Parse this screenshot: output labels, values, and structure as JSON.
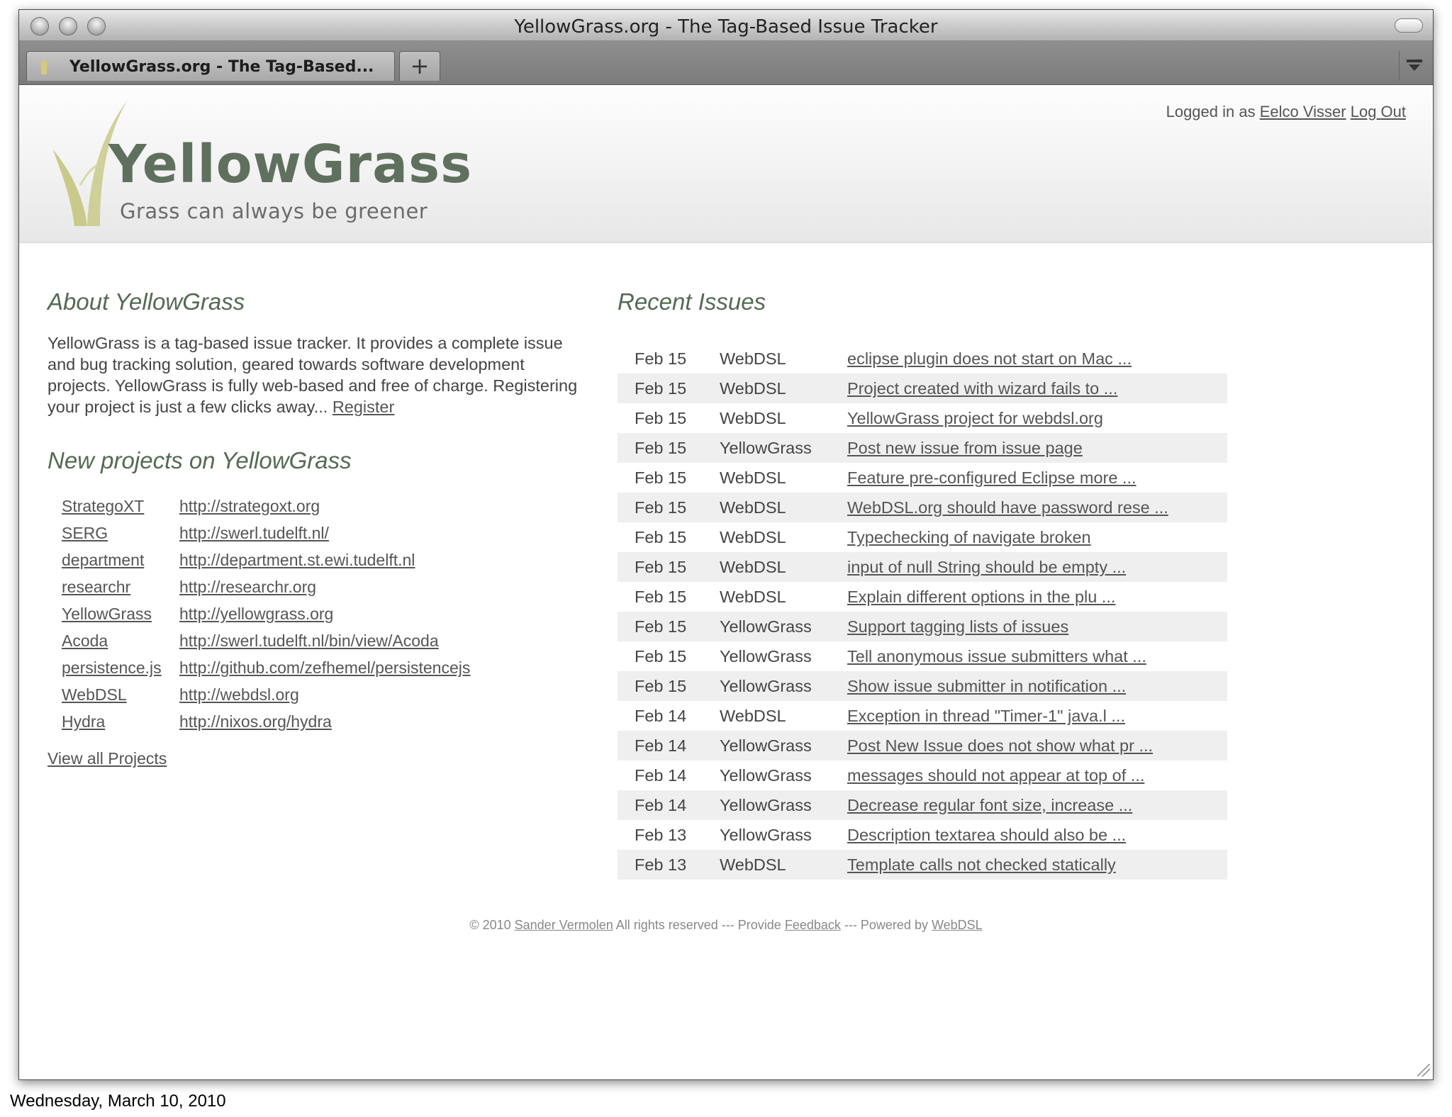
{
  "window": {
    "title": "YellowGrass.org - The Tag-Based Issue Tracker",
    "tab_label": "YellowGrass.org - The Tag-Based...",
    "new_tab_label": "+"
  },
  "header": {
    "logo_title": "YellowGrass",
    "logo_tagline": "Grass can always be greener",
    "logged_in_prefix": "Logged in as",
    "user_name": "Eelco Visser",
    "logout_label": "Log Out"
  },
  "about": {
    "heading": "About YellowGrass",
    "text": "YellowGrass is a tag-based issue tracker. It provides a complete issue and bug tracking solution, geared towards software development projects. YellowGrass is fully web-based and free of charge. Registering your project is just a few clicks away...",
    "register_label": "Register"
  },
  "new_projects": {
    "heading": "New projects on YellowGrass",
    "projects": [
      {
        "name": "StrategoXT",
        "url": "http://strategoxt.org"
      },
      {
        "name": "SERG",
        "url": "http://swerl.tudelft.nl/"
      },
      {
        "name": "department",
        "url": "http://department.st.ewi.tudelft.nl"
      },
      {
        "name": "researchr",
        "url": "http://researchr.org"
      },
      {
        "name": "YellowGrass",
        "url": "http://yellowgrass.org"
      },
      {
        "name": "Acoda",
        "url": "http://swerl.tudelft.nl/bin/view/Acoda"
      },
      {
        "name": "persistence.js",
        "url": "http://github.com/zefhemel/persistencejs"
      },
      {
        "name": "WebDSL",
        "url": "http://webdsl.org"
      },
      {
        "name": "Hydra",
        "url": "http://nixos.org/hydra"
      }
    ],
    "view_all_label": "View all Projects"
  },
  "recent_issues": {
    "heading": "Recent Issues",
    "issues": [
      {
        "date": "Feb 15",
        "project": "WebDSL",
        "title": "eclipse plugin does not start on Mac ..."
      },
      {
        "date": "Feb 15",
        "project": "WebDSL",
        "title": "Project created with wizard fails to ..."
      },
      {
        "date": "Feb 15",
        "project": "WebDSL",
        "title": "YellowGrass project for webdsl.org"
      },
      {
        "date": "Feb 15",
        "project": "YellowGrass",
        "title": "Post new issue from issue page"
      },
      {
        "date": "Feb 15",
        "project": "WebDSL",
        "title": "Feature pre-configured Eclipse more ..."
      },
      {
        "date": "Feb 15",
        "project": "WebDSL",
        "title": "WebDSL.org should have password rese ..."
      },
      {
        "date": "Feb 15",
        "project": "WebDSL",
        "title": "Typechecking of navigate broken"
      },
      {
        "date": "Feb 15",
        "project": "WebDSL",
        "title": "input of null String should be empty ..."
      },
      {
        "date": "Feb 15",
        "project": "WebDSL",
        "title": "Explain different options in the plu ..."
      },
      {
        "date": "Feb 15",
        "project": "YellowGrass",
        "title": "Support tagging lists of issues"
      },
      {
        "date": "Feb 15",
        "project": "YellowGrass",
        "title": "Tell anonymous issue submitters what ..."
      },
      {
        "date": "Feb 15",
        "project": "YellowGrass",
        "title": "Show issue submitter in notification ..."
      },
      {
        "date": "Feb 14",
        "project": "WebDSL",
        "title": "Exception in thread \"Timer-1\" java.l ..."
      },
      {
        "date": "Feb 14",
        "project": "YellowGrass",
        "title": "Post New Issue does not show what pr ..."
      },
      {
        "date": "Feb 14",
        "project": "YellowGrass",
        "title": "messages should not appear at top of ..."
      },
      {
        "date": "Feb 14",
        "project": "YellowGrass",
        "title": "Decrease regular font size, increase ..."
      },
      {
        "date": "Feb 13",
        "project": "YellowGrass",
        "title": "Description textarea should also be ..."
      },
      {
        "date": "Feb 13",
        "project": "WebDSL",
        "title": "Template calls not checked statically"
      }
    ]
  },
  "footer": {
    "copyright": "© 2010",
    "author": "Sander Vermolen",
    "rights_text": "All rights reserved --- Provide",
    "feedback_label": "Feedback",
    "powered_text": "--- Powered by",
    "webdsl_label": "WebDSL"
  },
  "slide_caption": "Wednesday, March 10, 2010",
  "colors": {
    "heading_green": "#546a52",
    "logo_green": "#60705e",
    "logo_mark_yellow": "#c9c98a"
  }
}
